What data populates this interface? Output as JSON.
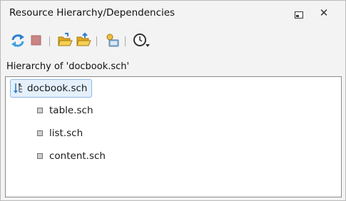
{
  "panel": {
    "title": "Resource Hierarchy/Dependencies"
  },
  "toolbar": {
    "buttons": [
      {
        "name": "refresh-icon"
      },
      {
        "name": "stop-icon"
      },
      {
        "name": "open-folder-icon"
      },
      {
        "name": "folder-up-icon"
      },
      {
        "name": "configure-icon"
      },
      {
        "name": "history-dropdown-icon"
      }
    ]
  },
  "hierarchy": {
    "label": "Hierarchy of 'docbook.sch'",
    "root": "docbook.sch",
    "children": [
      "table.sch",
      "list.sch",
      "content.sch"
    ]
  },
  "colors": {
    "selection_fill": "#e4f0fc",
    "selection_border": "#8fb8e3",
    "refresh_blue": "#2e7fd0",
    "stop_red": "#c98484",
    "folder_yellow": "#f0c040"
  }
}
